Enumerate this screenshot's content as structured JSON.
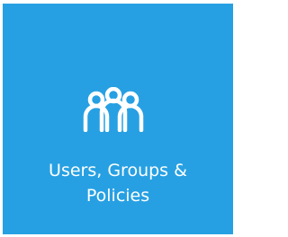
{
  "tile": {
    "label_line1": "Users, Groups &",
    "label_line2": "Policies",
    "icon": "users-group-icon",
    "background_color": "#27a0e3",
    "text_color": "#ffffff"
  }
}
